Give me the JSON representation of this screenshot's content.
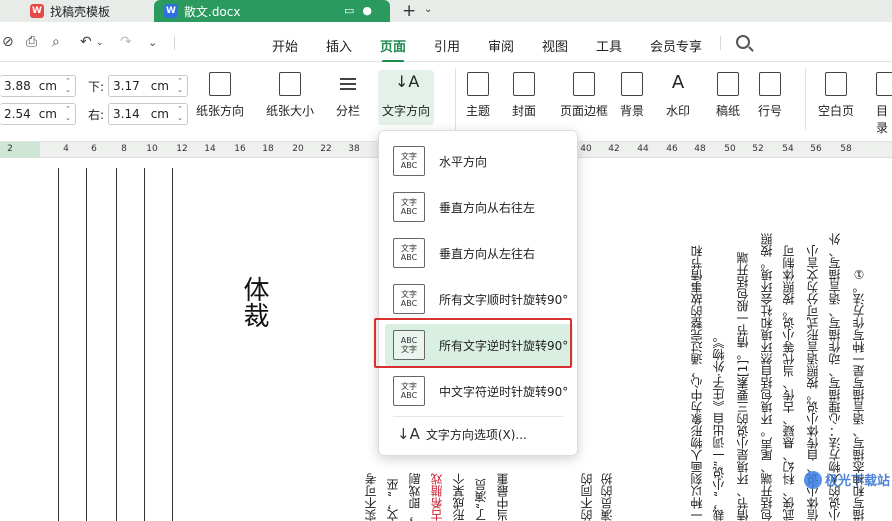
{
  "tabs": [
    {
      "label": "找稿壳模板"
    },
    {
      "label": "散文.docx"
    }
  ],
  "menu": {
    "items": [
      "开始",
      "插入",
      "页面",
      "引用",
      "审阅",
      "视图",
      "工具",
      "会员专享"
    ],
    "active": "页面"
  },
  "margins": {
    "top_value": "3.88",
    "top_unit": "cm",
    "bottom_label": "下:",
    "bottom_value": "3.17",
    "bottom_unit": "cm",
    "left_value": "2.54",
    "left_unit": "cm",
    "right_label": "右:",
    "right_value": "3.14",
    "right_unit": "cm"
  },
  "ribbon": {
    "paper_orientation": "纸张方向",
    "paper_size": "纸张大小",
    "columns": "分栏",
    "text_direction": "文字方向",
    "theme": "主题",
    "cover": "封面",
    "page_border": "页面边框",
    "background": "背景",
    "watermark": "水印",
    "manuscript": "稿纸",
    "line_number": "行号",
    "blank_page": "空白页",
    "toc": "目录"
  },
  "ruler": {
    "numbers": [
      "2",
      "2",
      "4",
      "6",
      "8",
      "10",
      "12",
      "14",
      "16",
      "18",
      "20",
      "22",
      "38",
      "40",
      "42",
      "44",
      "46",
      "48",
      "50",
      "52",
      "54",
      "56",
      "58"
    ]
  },
  "document": {
    "title_char": "体裁",
    "col1": "一种以刻画人物形象为中心，通过完整的故事情节和",
    "col2": "裁，“小说”一词出自《庄子·外物》。",
    "col3": "情节、环境是小说的三要素[1]。情节一般包括开端",
    "col4": "包括开端、尾声。环境包括自然环境和社会环境。按照",
    "col5": "武侠、科幻、悬疑、古传、当代等小说。按照体制可",
    "col6": "信体小说、自传体小说。按照语言形式可分为文言小",
    "col7": "小说的人物方法：心理描写、动作描写、语言描写、外",
    "col8": "描写和神态描写、语言描写是一种写作方法。①",
    "left_col1": "实不可考",
    "left_col2": "文，“巫",
    "left_col3": "，即戏剧",
    "left_col4": "古希腊戏",
    "left_col5": "形成某个",
    "left_col6": "了“演员",
    "left_col7": "当中最重",
    "left_col8": "的不同的",
    "left_col9": "演员的扮"
  },
  "dropdown": {
    "items": [
      {
        "label": "水平方向",
        "icon_top": "文字",
        "icon_bottom": "ABC"
      },
      {
        "label": "垂直方向从右往左",
        "icon_top": "文字",
        "icon_bottom": "ABC"
      },
      {
        "label": "垂直方向从左往右",
        "icon_top": "文字",
        "icon_bottom": "ABC"
      },
      {
        "label": "所有文字顺时针旋转90°",
        "icon_top": "文字",
        "icon_bottom": "ABC"
      },
      {
        "label": "所有文字逆时针旋转90°",
        "icon_top": "ABC",
        "icon_bottom": "文字"
      },
      {
        "label": "中文字符逆时针旋转90°",
        "icon_top": "文字",
        "icon_bottom": "ABC"
      }
    ],
    "options_label": "文字方向选项(X)..."
  },
  "watermark_text": "极光下载站",
  "colors": {
    "accent": "#1e8a4e",
    "active_tab": "#2a9a5f",
    "highlight_box": "#d93030"
  }
}
